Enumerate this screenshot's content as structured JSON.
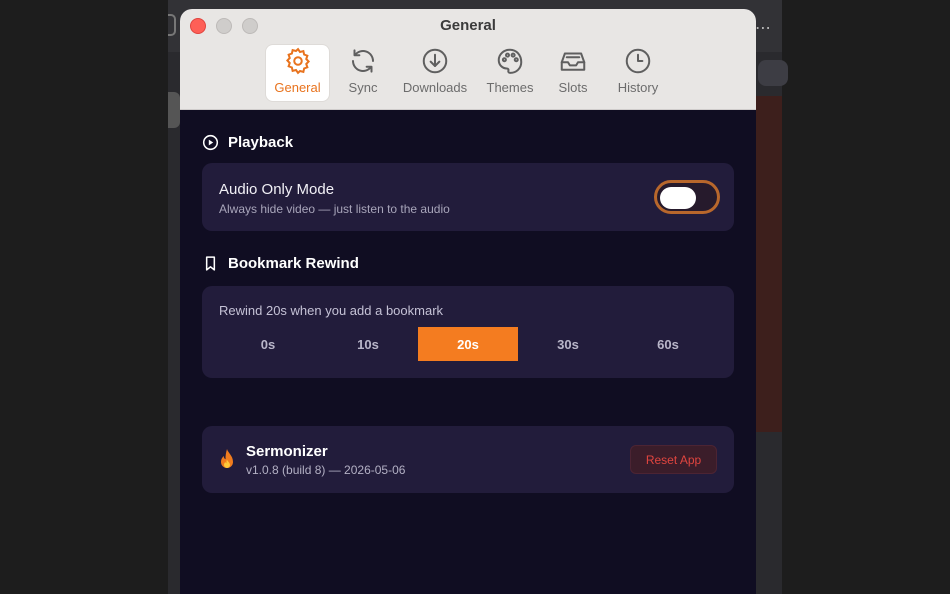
{
  "window": {
    "title": "General"
  },
  "tabs": [
    {
      "label": "General",
      "icon": "gear-icon"
    },
    {
      "label": "Sync",
      "icon": "sync-icon"
    },
    {
      "label": "Downloads",
      "icon": "download-icon"
    },
    {
      "label": "Themes",
      "icon": "palette-icon"
    },
    {
      "label": "Slots",
      "icon": "tray-icon"
    },
    {
      "label": "History",
      "icon": "clock-icon"
    }
  ],
  "active_tab": "General",
  "playback": {
    "heading": "Playback",
    "audio_only": {
      "title": "Audio Only Mode",
      "description": "Always hide video — just listen to the audio",
      "enabled": false
    }
  },
  "bookmark_rewind": {
    "heading": "Bookmark Rewind",
    "label": "Rewind 20s when you add a bookmark",
    "options": [
      "0s",
      "10s",
      "20s",
      "30s",
      "60s"
    ],
    "selected": "20s"
  },
  "about": {
    "app_name": "Sermonizer",
    "version": "v1.0.8 (build 8) — 2026-05-06",
    "reset_label": "Reset App"
  },
  "colors": {
    "accent": "#f47c20",
    "danger": "#e0453f",
    "panel": "#221c3b",
    "background": "#100d22"
  }
}
